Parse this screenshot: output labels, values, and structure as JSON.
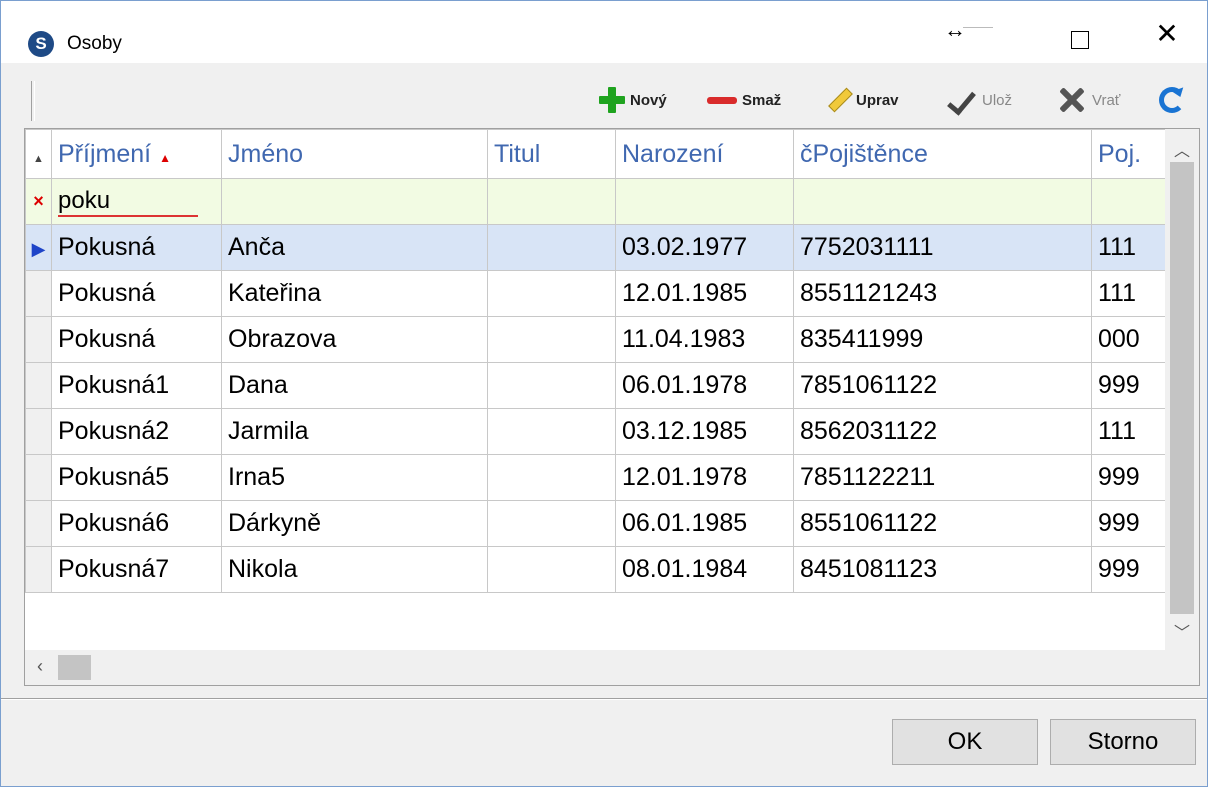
{
  "window": {
    "title": "Osoby",
    "app_icon_letter": "S"
  },
  "title_controls": {
    "resize_glyph": "↔",
    "close_glyph": "✕"
  },
  "toolbar": {
    "new_label": "Nový",
    "delete_label": "Smaž",
    "edit_label": "Uprav",
    "save_label": "Ulož",
    "revert_label": "Vrať",
    "icons": [
      "plus-icon",
      "minus-icon",
      "pencil-icon",
      "check-icon",
      "xmark-icon",
      "refresh-icon"
    ],
    "accent_colors": {
      "new": "#1fa31f",
      "delete": "#d92b2b",
      "refresh": "#1a74d3"
    }
  },
  "grid": {
    "columns": [
      "Příjmení",
      "Jméno",
      "Titul",
      "Narození",
      "čPojištěnce",
      "Poj."
    ],
    "sort_column": "Příjmení",
    "filter": {
      "column": "Příjmení",
      "value": "poku",
      "clear_glyph": "×"
    },
    "selected_row": 0,
    "rows": [
      [
        "Pokusná",
        "Anča",
        "",
        "03.02.1977",
        "7752031111",
        "111"
      ],
      [
        "Pokusná",
        "Kateřina",
        "",
        "12.01.1985",
        "8551121243",
        "111"
      ],
      [
        "Pokusná",
        "Obrazova",
        "",
        "11.04.1983",
        "835411999",
        "000"
      ],
      [
        "Pokusná1",
        "Dana",
        "",
        "06.01.1978",
        "7851061122",
        "999"
      ],
      [
        "Pokusná2",
        "Jarmila",
        "",
        "03.12.1985",
        "8562031122",
        "111"
      ],
      [
        "Pokusná5",
        "Irna5",
        "",
        "12.01.1978",
        "7851122211",
        "999"
      ],
      [
        "Pokusná6",
        "Dárkyně",
        "",
        "06.01.1985",
        "8551061122",
        "999"
      ],
      [
        "Pokusná7",
        "Nikola",
        "",
        "08.01.1984",
        "8451081123",
        "999"
      ]
    ]
  },
  "buttons": {
    "ok_label": "OK",
    "cancel_label": "Storno"
  }
}
